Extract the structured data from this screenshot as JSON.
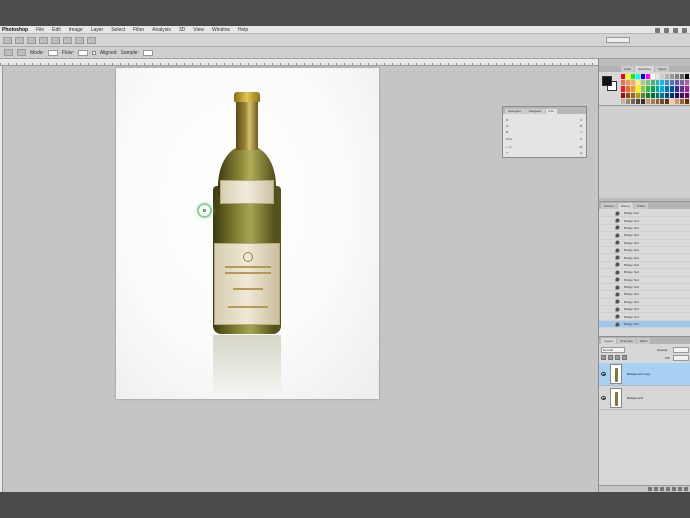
{
  "menubar": {
    "app_name": "Photoshop",
    "items": [
      "File",
      "Edit",
      "Image",
      "Layer",
      "Select",
      "Filter",
      "Analysis",
      "3D",
      "View",
      "Window",
      "Help"
    ]
  },
  "optionsbar": {
    "mode_label": "Mode:",
    "flow_label": "Flow:",
    "sample_label": "Sample:",
    "aligned_label": "Aligned"
  },
  "info_panel": {
    "tabs": [
      "Histogram",
      "Navigator",
      "Info"
    ],
    "rows": [
      {
        "left": "R:",
        "right": "C:"
      },
      {
        "left": "G:",
        "right": "M:"
      },
      {
        "left": "B:",
        "right": "Y:"
      },
      {
        "left": "8-bit",
        "right": "K:"
      },
      {
        "left": "+, X:",
        "right": "W:"
      },
      {
        "left": "Y:",
        "right": "H:"
      }
    ]
  },
  "swatches_panel": {
    "tabs": [
      "Color",
      "Swatches",
      "Styles"
    ],
    "foreground_color": "#111111",
    "background_color": "#ffffff",
    "swatch_colors": [
      "#ff0000",
      "#ffff00",
      "#00ff00",
      "#00ffff",
      "#0000ff",
      "#ff00ff",
      "#ffffff",
      "#e6e6e6",
      "#cccccc",
      "#b3b3b3",
      "#999999",
      "#808080",
      "#666666",
      "#000000",
      "#f26c4f",
      "#f68e55",
      "#fbaf5c",
      "#fff467",
      "#acd372",
      "#7cc576",
      "#3bb878",
      "#1abbb4",
      "#00bff3",
      "#438ccb",
      "#5574b9",
      "#605ca8",
      "#855fa8",
      "#a763a8",
      "#ed1c24",
      "#f26522",
      "#f7941d",
      "#fff200",
      "#8dc63f",
      "#39b54a",
      "#00a651",
      "#00a99d",
      "#00aeef",
      "#0072bc",
      "#0054a6",
      "#2e3192",
      "#662d91",
      "#92278f",
      "#9e0b0f",
      "#a0410d",
      "#a36209",
      "#aba000",
      "#598527",
      "#1a7b30",
      "#007236",
      "#00746b",
      "#0076a3",
      "#004b80",
      "#003471",
      "#1b1464",
      "#440e62",
      "#630460",
      "#c7b299",
      "#998675",
      "#736357",
      "#534741",
      "#37302d",
      "#c69c6d",
      "#a67c52",
      "#8c6239",
      "#754c24",
      "#603913",
      "#ffcc99",
      "#cc9966",
      "#996633",
      "#663300"
    ]
  },
  "history_panel": {
    "tabs": [
      "Actions",
      "History",
      "Paths"
    ],
    "items": [
      "Bridge Tool",
      "Bridge Tool",
      "Bridge Tool",
      "Bridge Tool",
      "Bridge Tool",
      "Bridge Tool",
      "Bridge Tool",
      "Bridge Tool",
      "Bridge Tool",
      "Bridge Tool",
      "Bridge Tool",
      "Bridge Tool",
      "Bridge Tool",
      "Bridge Tool",
      "Bridge Tool",
      "Bridge Tool"
    ]
  },
  "layers_panel": {
    "tabs": [
      "Layers",
      "Channels",
      "Paths"
    ],
    "blend_mode": "Normal",
    "opacity_label": "Opacity:",
    "fill_label": "Fill:",
    "layers": [
      {
        "name": "Background copy"
      },
      {
        "name": "Background"
      }
    ]
  }
}
